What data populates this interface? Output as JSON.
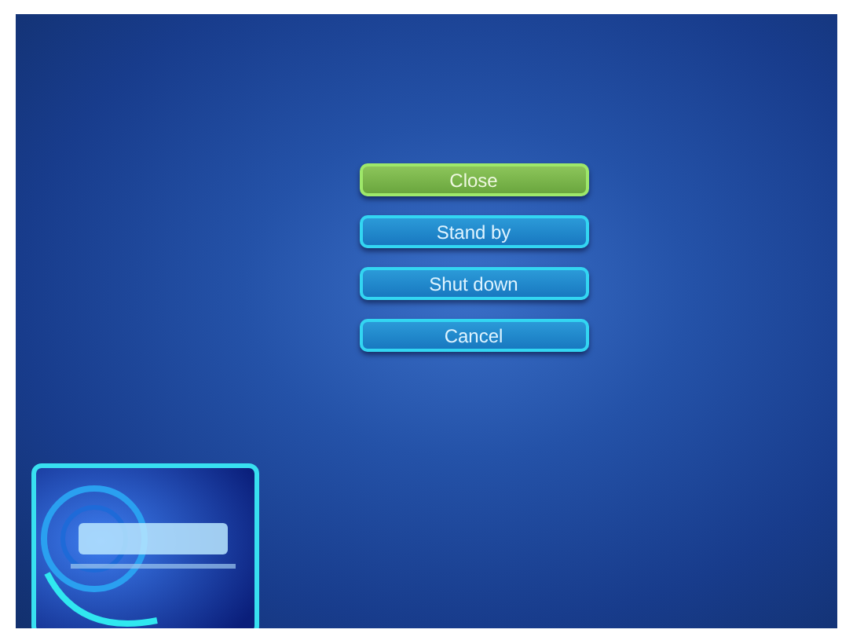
{
  "menu": [
    {
      "label": "Close",
      "selected": true
    },
    {
      "label": "Stand by",
      "selected": false
    },
    {
      "label": "Shut down",
      "selected": false
    },
    {
      "label": "Cancel",
      "selected": false
    }
  ]
}
